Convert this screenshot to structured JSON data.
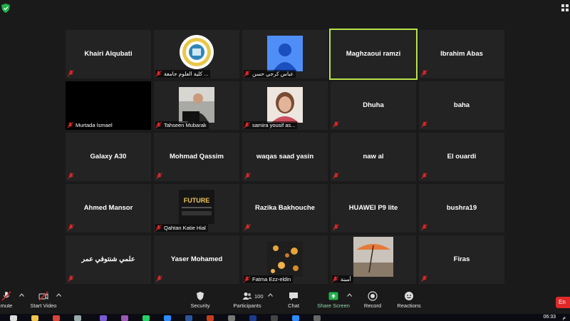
{
  "participants": [
    {
      "name": "Khairi Alqubati",
      "label": "",
      "kind": "name"
    },
    {
      "name": "",
      "label": "كلية العلوم جامعة ...",
      "kind": "logo"
    },
    {
      "name": "",
      "label": "عباس كرجي حسن",
      "kind": "avatar"
    },
    {
      "name": "Maghzaoui ramzi",
      "label": "",
      "kind": "name",
      "active_speaker": true
    },
    {
      "name": "Ibrahim Abas",
      "label": "",
      "kind": "name"
    },
    {
      "name": "",
      "label": "Murtada Ismael",
      "kind": "black"
    },
    {
      "name": "",
      "label": "Tahseen Mubarak",
      "kind": "video-man"
    },
    {
      "name": "",
      "label": "samira yousif as...",
      "kind": "video-woman"
    },
    {
      "name": "Dhuha",
      "label": "",
      "kind": "name"
    },
    {
      "name": "baha",
      "label": "",
      "kind": "name"
    },
    {
      "name": "Galaxy A30",
      "label": "",
      "kind": "name"
    },
    {
      "name": "Mohmad Qassim",
      "label": "",
      "kind": "name"
    },
    {
      "name": "waqas saad yasin",
      "label": "",
      "kind": "name"
    },
    {
      "name": "naw al",
      "label": "",
      "kind": "name"
    },
    {
      "name": "El ouardi",
      "label": "",
      "kind": "name"
    },
    {
      "name": "Ahmed Mansor",
      "label": "",
      "kind": "name"
    },
    {
      "name": "",
      "label": "Qahtan Katie Hial",
      "kind": "future",
      "image_text": "FUTURE"
    },
    {
      "name": "Razika Bakhouche",
      "label": "",
      "kind": "name"
    },
    {
      "name": "HUAWEI P9 lite",
      "label": "",
      "kind": "name"
    },
    {
      "name": "bushra19",
      "label": "",
      "kind": "name"
    },
    {
      "name": "علمي شنتوفي عمر",
      "label": "",
      "kind": "name"
    },
    {
      "name": "Yaser Mohamed",
      "label": "",
      "kind": "name"
    },
    {
      "name": "",
      "label": "Fatma Ezz-eldin",
      "kind": "flowers"
    },
    {
      "name": "",
      "label": "أمينة",
      "kind": "umbrella"
    },
    {
      "name": "Firas",
      "label": "",
      "kind": "name"
    }
  ],
  "toolbar": {
    "mute": "mute",
    "start_video": "Start Video",
    "security": "Security",
    "participants": "Participants",
    "participants_count": "100",
    "chat": "Chat",
    "share_screen": "Share Screen",
    "record": "Record",
    "reactions": "Reactions",
    "end": "En"
  },
  "taskbar": {
    "time": "06:33",
    "locale": "م"
  },
  "colors": {
    "active_speaker_border": "#b8e24a",
    "muted_mic": "#e02828",
    "share_green": "#22b14c",
    "end_red": "#e02828"
  }
}
